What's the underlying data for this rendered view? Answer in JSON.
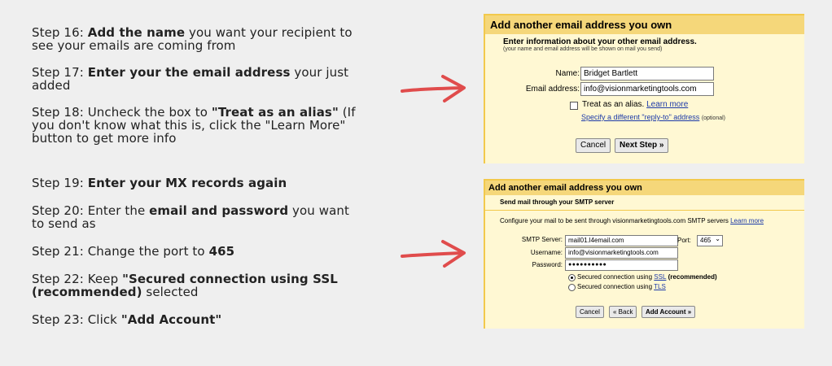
{
  "steps_top": [
    {
      "prefix": "Step 16: ",
      "bold": "Add the name",
      "suffix": " you want your recipient to see your emails are coming from"
    },
    {
      "prefix": "Step 17: ",
      "bold": "Enter your the email address",
      "suffix": " your just added"
    },
    {
      "prefix": "Step 18: Uncheck the box to ",
      "bold": "\"Treat as an alias\"",
      "suffix": " (If you don't know what this is, click the \"Learn More\" button to get more info"
    }
  ],
  "steps_bottom": [
    {
      "prefix": "Step 19: ",
      "bold": "Enter your MX records again",
      "suffix": ""
    },
    {
      "prefix": "Step 20: Enter the ",
      "bold": "email and password",
      "suffix": " you want to send as"
    },
    {
      "prefix": "Step 21: Change the port to ",
      "bold": "465",
      "suffix": ""
    },
    {
      "prefix": "Step 22: Keep ",
      "bold": "\"Secured connection using SSL (recommended)",
      "suffix": " selected"
    },
    {
      "prefix": "Step 23: Click ",
      "bold": "\"Add Account\"",
      "suffix": ""
    }
  ],
  "panel1": {
    "title": "Add another email address you own",
    "subtitle": "Enter information about your other email address.",
    "note": "(your name and email address will be shown on mail you send)",
    "name_label": "Name:",
    "name_value": "Bridget Bartlett",
    "email_label": "Email address:",
    "email_value": "info@visionmarketingtools.com",
    "alias_label": "Treat as an alias.",
    "learn_more": "Learn more",
    "reply_to": "Specify a different \"reply-to\" address",
    "optional": "(optional)",
    "cancel": "Cancel",
    "next": "Next Step »"
  },
  "panel2": {
    "title": "Add another email address you own",
    "subtitle": "Send mail through your SMTP server",
    "config_text": "Configure your mail to be sent through visionmarketingtools.com SMTP servers",
    "learn_more": "Learn more",
    "smtp_label": "SMTP Server:",
    "smtp_value": "mail01.l4email.com",
    "port_label": "Port:",
    "port_value": "465",
    "username_label": "Username:",
    "username_value": "info@visionmarketingtools.com",
    "password_label": "Password:",
    "password_value": "●●●●●●●●●●",
    "ssl_prefix": "Secured connection using ",
    "ssl_link": "SSL",
    "ssl_suffix": " (recommended)",
    "tls_prefix": "Secured connection using ",
    "tls_link": "TLS",
    "cancel": "Cancel",
    "back": "« Back",
    "add": "Add Account »"
  },
  "colors": {
    "arrow": "#e04c4c",
    "panel_bg": "#fff8d3",
    "title_bg": "#f5d77a"
  }
}
